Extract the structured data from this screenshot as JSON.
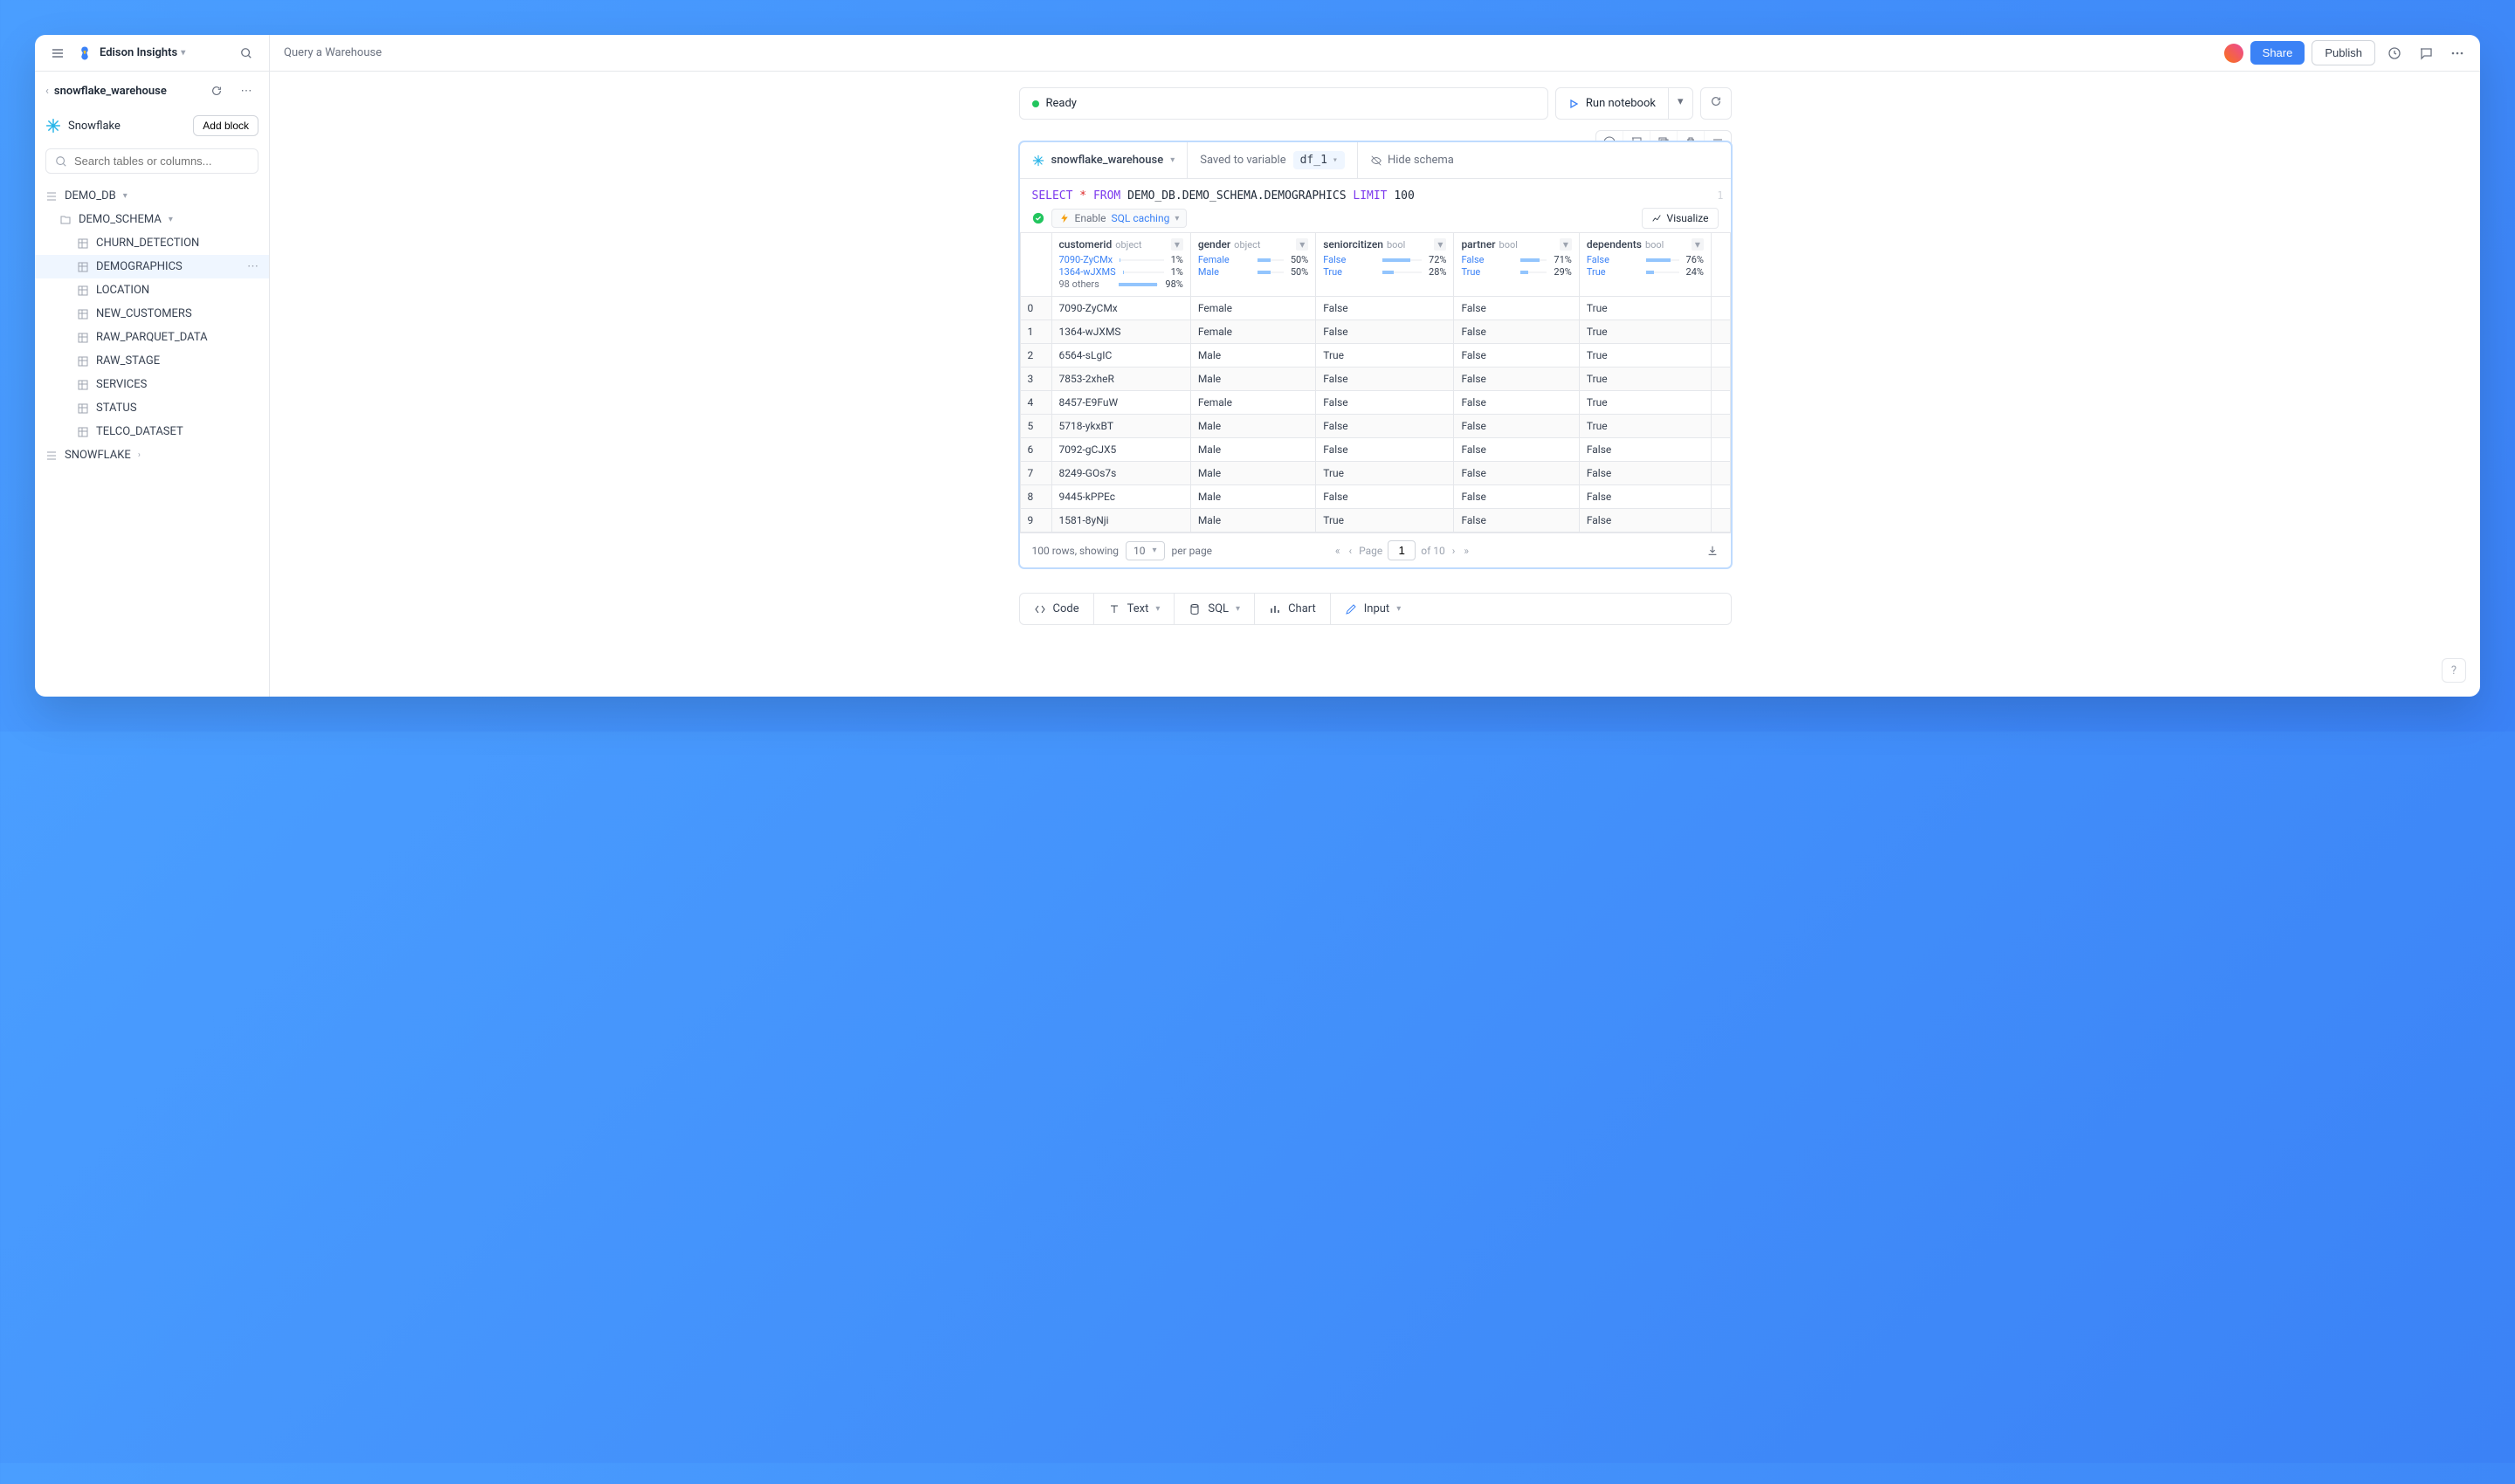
{
  "header": {
    "workspace": "Edison Insights",
    "page_title": "Query a Warehouse",
    "share": "Share",
    "publish": "Publish"
  },
  "sidebar": {
    "breadcrumb": "snowflake_warehouse",
    "connection": "Snowflake",
    "add_block": "Add block",
    "search_placeholder": "Search tables or columns...",
    "db": "DEMO_DB",
    "schema": "DEMO_SCHEMA",
    "tables": [
      "CHURN_DETECTION",
      "DEMOGRAPHICS",
      "LOCATION",
      "NEW_CUSTOMERS",
      "RAW_PARQUET_DATA",
      "RAW_STAGE",
      "SERVICES",
      "STATUS",
      "TELCO_DATASET"
    ],
    "active_table": "DEMOGRAPHICS",
    "bottom_db": "SNOWFLAKE"
  },
  "status": {
    "text": "Ready",
    "run": "Run notebook"
  },
  "cell": {
    "connection": "snowflake_warehouse",
    "saved_to": "Saved to variable",
    "variable": "df_1",
    "hide_schema": "Hide schema",
    "sql_prefix": "SELECT",
    "sql_star": "*",
    "sql_from": "FROM",
    "sql_table": "DEMO_DB.DEMO_SCHEMA.DEMOGRAPHICS",
    "sql_limit": "LIMIT",
    "sql_limitn": "100",
    "enable": "Enable",
    "sql_caching": "SQL caching",
    "visualize": "Visualize",
    "columns": [
      {
        "name": "customerid",
        "type": "object",
        "stats": [
          {
            "label": "7090-ZyCMx",
            "pct": "1%",
            "w": "1%"
          },
          {
            "label": "1364-wJXMS",
            "pct": "1%",
            "w": "1%"
          },
          {
            "label": "98 others",
            "pct": "98%",
            "w": "98%",
            "gray": true
          }
        ]
      },
      {
        "name": "gender",
        "type": "object",
        "stats": [
          {
            "label": "Female",
            "pct": "50%",
            "w": "50%"
          },
          {
            "label": "Male",
            "pct": "50%",
            "w": "50%"
          }
        ]
      },
      {
        "name": "seniorcitizen",
        "type": "bool",
        "stats": [
          {
            "label": "False",
            "pct": "72%",
            "w": "72%"
          },
          {
            "label": "True",
            "pct": "28%",
            "w": "28%"
          }
        ]
      },
      {
        "name": "partner",
        "type": "bool",
        "stats": [
          {
            "label": "False",
            "pct": "71%",
            "w": "71%"
          },
          {
            "label": "True",
            "pct": "29%",
            "w": "29%"
          }
        ]
      },
      {
        "name": "dependents",
        "type": "bool",
        "stats": [
          {
            "label": "False",
            "pct": "76%",
            "w": "76%"
          },
          {
            "label": "True",
            "pct": "24%",
            "w": "24%"
          }
        ]
      }
    ],
    "rows": [
      [
        "0",
        "7090-ZyCMx",
        "Female",
        "False",
        "False",
        "True"
      ],
      [
        "1",
        "1364-wJXMS",
        "Female",
        "False",
        "False",
        "True"
      ],
      [
        "2",
        "6564-sLgIC",
        "Male",
        "True",
        "False",
        "True"
      ],
      [
        "3",
        "7853-2xheR",
        "Male",
        "False",
        "False",
        "True"
      ],
      [
        "4",
        "8457-E9FuW",
        "Female",
        "False",
        "False",
        "True"
      ],
      [
        "5",
        "5718-ykxBT",
        "Male",
        "False",
        "False",
        "True"
      ],
      [
        "6",
        "7092-gCJX5",
        "Male",
        "False",
        "False",
        "False"
      ],
      [
        "7",
        "8249-GOs7s",
        "Male",
        "True",
        "False",
        "False"
      ],
      [
        "8",
        "9445-kPPEc",
        "Male",
        "False",
        "False",
        "False"
      ],
      [
        "9",
        "1581-8yNji",
        "Male",
        "True",
        "False",
        "False"
      ]
    ],
    "footer": {
      "rows_showing": "100 rows, showing",
      "per_page_value": "10",
      "per_page_label": "per page",
      "page_label": "Page",
      "page_value": "1",
      "of_pages": "of 10"
    }
  },
  "palette": {
    "code": "Code",
    "text": "Text",
    "sql": "SQL",
    "chart": "Chart",
    "input": "Input"
  }
}
